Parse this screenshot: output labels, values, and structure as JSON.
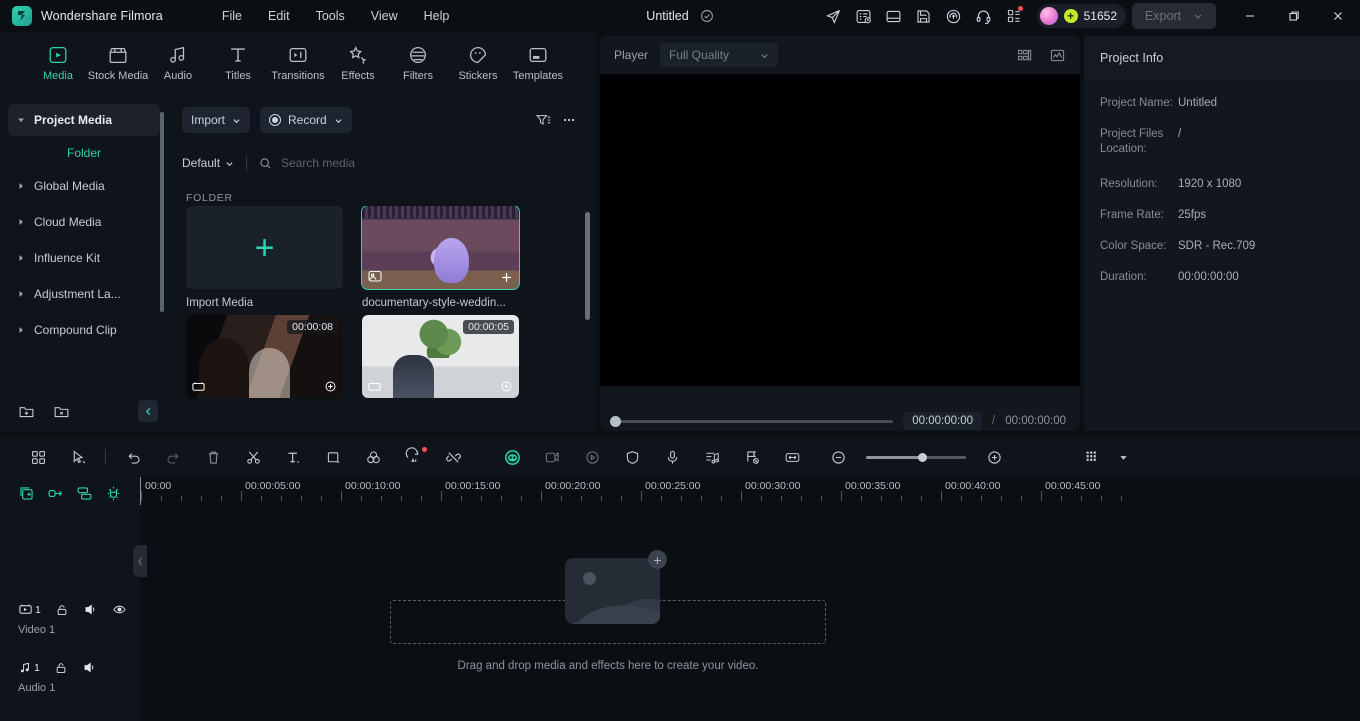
{
  "titlebar": {
    "brand": "Wondershare Filmora",
    "menus": [
      "File",
      "Edit",
      "Tools",
      "View",
      "Help"
    ],
    "doc_title": "Untitled",
    "icons": [
      "send-icon",
      "task-list-icon",
      "layout-icon",
      "save-icon",
      "cloud-upload-icon",
      "headset-icon",
      "apps-grid-icon"
    ],
    "credits": "51652",
    "export_label": "Export",
    "window_controls": [
      "minimize",
      "restore",
      "close"
    ]
  },
  "tooltabs": [
    {
      "label": "Media",
      "icon": "media-icon",
      "active": true
    },
    {
      "label": "Stock Media",
      "icon": "stock-media-icon",
      "active": false
    },
    {
      "label": "Audio",
      "icon": "audio-icon",
      "active": false
    },
    {
      "label": "Titles",
      "icon": "titles-icon",
      "active": false
    },
    {
      "label": "Transitions",
      "icon": "transitions-icon",
      "active": false
    },
    {
      "label": "Effects",
      "icon": "effects-icon",
      "active": false
    },
    {
      "label": "Filters",
      "icon": "filters-icon",
      "active": false
    },
    {
      "label": "Stickers",
      "icon": "stickers-icon",
      "active": false
    },
    {
      "label": "Templates",
      "icon": "templates-icon",
      "active": false
    }
  ],
  "library": {
    "items": [
      {
        "label": "Project Media",
        "expanded": true,
        "selected": true
      },
      {
        "label": "Folder",
        "sub": true
      },
      {
        "label": "Global Media",
        "expanded": false
      },
      {
        "label": "Cloud Media",
        "expanded": false
      },
      {
        "label": "Influence Kit",
        "expanded": false
      },
      {
        "label": "Adjustment La...",
        "expanded": false
      },
      {
        "label": "Compound Clip",
        "expanded": false
      }
    ],
    "bottom_icons": [
      "new-folder-icon",
      "delete-folder-icon",
      "collapse-panel-icon"
    ]
  },
  "media": {
    "import_label": "Import",
    "record_label": "Record",
    "filter_icon": "filter-icon",
    "more_icon": "more-options-icon",
    "sort_label": "Default",
    "search_placeholder": "Search media",
    "section_label": "FOLDER",
    "items": [
      {
        "name": "Import Media",
        "type": "import-tile",
        "duration": "",
        "selected": false
      },
      {
        "name": "documentary-style-weddin...",
        "type": "clip",
        "duration": "",
        "selected": true
      },
      {
        "name": "",
        "type": "clip",
        "duration": "00:00:08",
        "selected": false
      },
      {
        "name": "",
        "type": "clip",
        "duration": "00:00:05",
        "selected": false
      }
    ]
  },
  "player": {
    "label": "Player",
    "quality": "Full Quality",
    "header_icons": [
      "split-view-icon",
      "waveform-icon"
    ],
    "current_time": "00:00:00:00",
    "separator": "/",
    "total_time": "00:00:00:00",
    "controls": [
      "prev-frame-icon",
      "next-frame-icon",
      "play-icon",
      "stop-icon",
      "mark-in-icon",
      "mark-out-icon",
      "export-frame-icon",
      "chevron-down-icon",
      "snapshot-screen-icon",
      "camera-icon",
      "volume-icon",
      "fullscreen-icon"
    ]
  },
  "project_info": {
    "title": "Project Info",
    "rows": [
      {
        "key": "Project Name:",
        "value": "Untitled"
      },
      {
        "key": "Project Files Location:",
        "value": "/"
      },
      {
        "key": "Resolution:",
        "value": "1920 x 1080"
      },
      {
        "key": "Frame Rate:",
        "value": "25fps"
      },
      {
        "key": "Color Space:",
        "value": "SDR - Rec.709"
      },
      {
        "key": "Duration:",
        "value": "00:00:00:00"
      }
    ]
  },
  "timeline_toolbar": {
    "icons": [
      "grid-view-icon",
      "selection-tool-icon",
      "undo-icon",
      "redo-icon",
      "delete-icon",
      "split-icon",
      "text-icon",
      "crop-icon",
      "color-icon",
      "ai-tools-icon",
      "unlink-icon",
      "ai-copilot-icon",
      "smart-cutout-icon",
      "speed-icon",
      "mask-icon",
      "voiceover-icon",
      "audio-mixer-icon",
      "marker-icon",
      "fit-timeline-icon",
      "zoom-out-icon",
      "zoom-in-icon",
      "track-manager-icon",
      "chevron-down-icon"
    ]
  },
  "timeline": {
    "head_tools": [
      "add-track-icon",
      "link-icon",
      "auto-arrange-icon",
      "magnet-snap-icon"
    ],
    "ruler_labels": [
      "00:00",
      "00:00:05:00",
      "00:00:10:00",
      "00:00:15:00",
      "00:00:20:00",
      "00:00:25:00",
      "00:00:30:00",
      "00:00:35:00",
      "00:00:40:00",
      "00:00:45:00"
    ],
    "tracks": [
      {
        "name": "Video 1",
        "count": "1",
        "icons": [
          "video-track-icon",
          "lock-icon",
          "mute-icon",
          "visibility-icon"
        ]
      },
      {
        "name": "Audio 1",
        "count": "1",
        "icons": [
          "audio-track-icon",
          "lock-icon",
          "mute-icon"
        ]
      }
    ],
    "drop_text": "Drag and drop media and effects here to create your video."
  },
  "colors": {
    "accent": "#2fd3b0",
    "panel": "#0f131a",
    "background": "#0b0e13",
    "credit_coin": "#c4e82a",
    "alert": "#ff4d4f"
  }
}
